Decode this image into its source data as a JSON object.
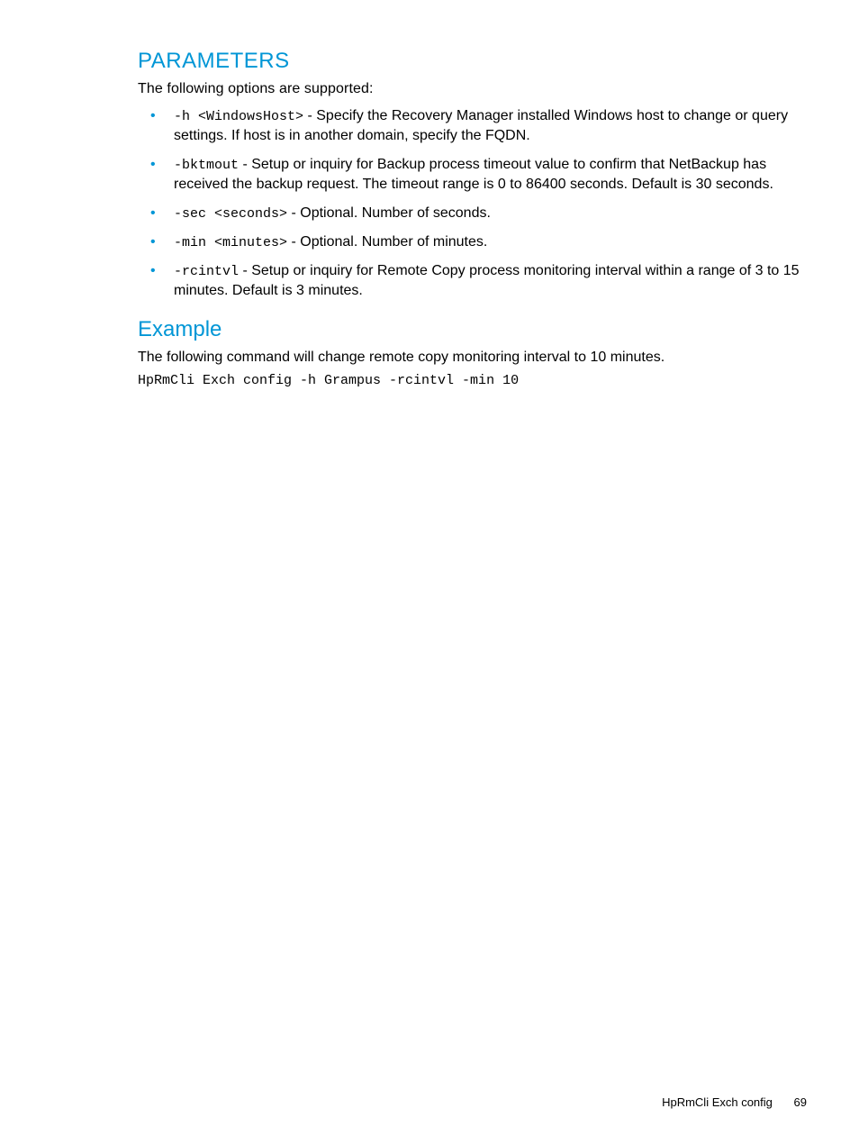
{
  "headings": {
    "parameters": "PARAMETERS",
    "example": "Example"
  },
  "intro": "The following options are supported:",
  "params": [
    {
      "code": "-h <WindowsHost>",
      "text": " - Specify the Recovery Manager installed Windows host to change or query settings. If host is in another domain, specify the FQDN."
    },
    {
      "code": "-bktmout",
      "text": " - Setup or inquiry for Backup process timeout value to confirm that NetBackup has received the backup request. The timeout range is 0 to 86400 seconds. Default is 30 seconds."
    },
    {
      "code": "-sec <seconds>",
      "text": " - Optional. Number of seconds."
    },
    {
      "code": "-min <minutes>",
      "text": " - Optional. Number of minutes."
    },
    {
      "code": "-rcintvl",
      "text": " - Setup or inquiry for Remote Copy process monitoring interval within a range of 3 to 15 minutes. Default is 3 minutes."
    }
  ],
  "example": {
    "text": "The following command will change remote copy monitoring interval to 10 minutes.",
    "code": "HpRmCli Exch config -h Grampus -rcintvl -min 10"
  },
  "footer": {
    "title": "HpRmCli Exch config",
    "page": "69"
  }
}
